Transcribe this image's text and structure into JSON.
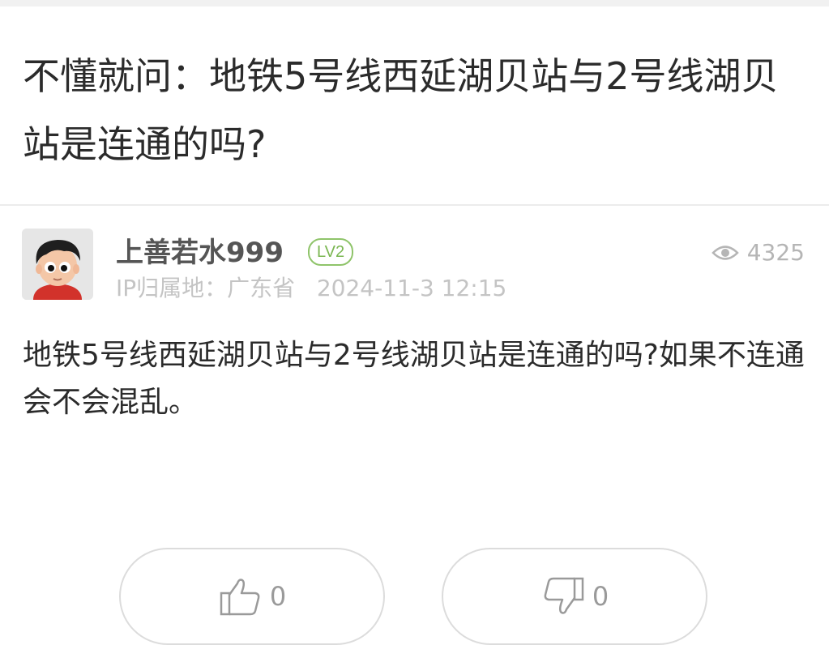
{
  "post": {
    "title": "不懂就问：地铁5号线西延湖贝站与2号线湖贝站是连通的吗?",
    "body": "地铁5号线西延湖贝站与2号线湖贝站是连通的吗?如果不连通会不会混乱。"
  },
  "author": {
    "name": "上善若水999",
    "level": "LV2",
    "ip_location": "IP归属地：广东省",
    "timestamp": "2024-11-3 12:15"
  },
  "stats": {
    "views": "4325",
    "view_icon": "eye-icon"
  },
  "actions": {
    "like_count": "0",
    "dislike_count": "0",
    "like_icon": "thumbs-up-icon",
    "dislike_icon": "thumbs-down-icon"
  },
  "colors": {
    "level_badge": "#7ab651",
    "muted_text": "#c4c4c4"
  }
}
